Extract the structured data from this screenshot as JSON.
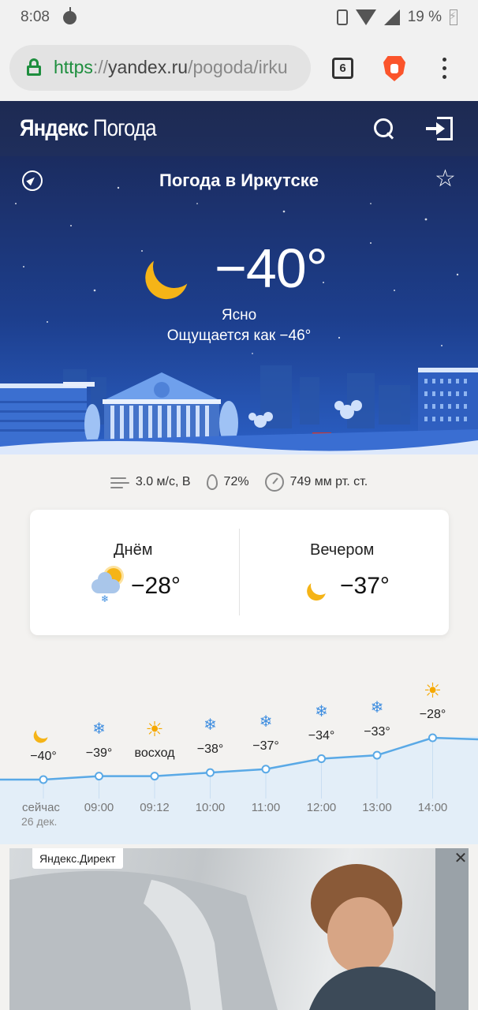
{
  "status": {
    "time": "8:08",
    "battery": "19 %"
  },
  "browser": {
    "url_scheme": "https",
    "url_sep": "://",
    "url_host": "yandex.ru",
    "url_path": "/pogoda/irku",
    "tab_count": "6"
  },
  "header": {
    "logo_brand": "Яндекс",
    "logo_service": "Погода"
  },
  "hero": {
    "title": "Погода в Иркутске",
    "temperature": "−40°",
    "condition": "Ясно",
    "feels_like": "Ощущается как −46°"
  },
  "details": {
    "wind": "3.0 м/с, В",
    "humidity": "72%",
    "pressure": "749 мм рт. ст."
  },
  "day_card": {
    "day_label": "Днём",
    "day_temp": "−28°",
    "evening_label": "Вечером",
    "evening_temp": "−37°"
  },
  "hourly": {
    "date": "26 дек.",
    "items": [
      {
        "time": "сейчас",
        "label": "−40°",
        "temp": -40,
        "icon": "moon-icon"
      },
      {
        "time": "09:00",
        "label": "−39°",
        "temp": -39,
        "icon": "snowflake-icon"
      },
      {
        "time": "09:12",
        "label": "восход",
        "temp": -39,
        "icon": "sun-icon"
      },
      {
        "time": "10:00",
        "label": "−38°",
        "temp": -38,
        "icon": "snowflake-icon"
      },
      {
        "time": "11:00",
        "label": "−37°",
        "temp": -37,
        "icon": "snowflake-icon"
      },
      {
        "time": "12:00",
        "label": "−34°",
        "temp": -34,
        "icon": "snowflake-icon"
      },
      {
        "time": "13:00",
        "label": "−33°",
        "temp": -33,
        "icon": "snowflake-icon"
      },
      {
        "time": "14:00",
        "label": "−28°",
        "temp": -28,
        "icon": "sun-icon"
      }
    ]
  },
  "ad": {
    "badge": "Яндекс.Директ"
  },
  "colors": {
    "accent_line": "#5aa9e6",
    "sun": "#f5b417",
    "snow": "#3f8ee0"
  }
}
